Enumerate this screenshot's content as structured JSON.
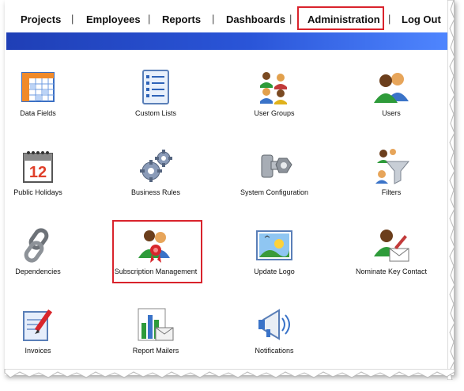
{
  "nav": {
    "items": [
      {
        "label": "Projects"
      },
      {
        "label": "Employees"
      },
      {
        "label": "Reports"
      },
      {
        "label": "Dashboards"
      },
      {
        "label": "Administration"
      },
      {
        "label": "Log Out"
      }
    ],
    "separator": "|",
    "active_color": "#d9232c",
    "banner_color": "#2a55d8"
  },
  "tiles": [
    {
      "label": "Data Fields",
      "icon": "table-grid-icon"
    },
    {
      "label": "Custom Lists",
      "icon": "list-document-icon"
    },
    {
      "label": "User Groups",
      "icon": "user-group-icon"
    },
    {
      "label": "Users",
      "icon": "users-icon"
    },
    {
      "label": "Public Holidays",
      "icon": "calendar-icon"
    },
    {
      "label": "Business Rules",
      "icon": "gears-icon"
    },
    {
      "label": "System Configuration",
      "icon": "nut-bolt-icon"
    },
    {
      "label": "Filters",
      "icon": "funnel-users-icon"
    },
    {
      "label": "Dependencies",
      "icon": "chain-link-icon"
    },
    {
      "label": "Subscription Management",
      "icon": "user-ribbon-icon"
    },
    {
      "label": "Update Logo",
      "icon": "landscape-picture-icon"
    },
    {
      "label": "Nominate Key Contact",
      "icon": "user-envelope-icon"
    },
    {
      "label": "Invoices",
      "icon": "document-pen-icon"
    },
    {
      "label": "Report Mailers",
      "icon": "chart-envelope-icon"
    },
    {
      "label": "Notifications",
      "icon": "megaphone-icon"
    }
  ],
  "calendar_day": "12"
}
